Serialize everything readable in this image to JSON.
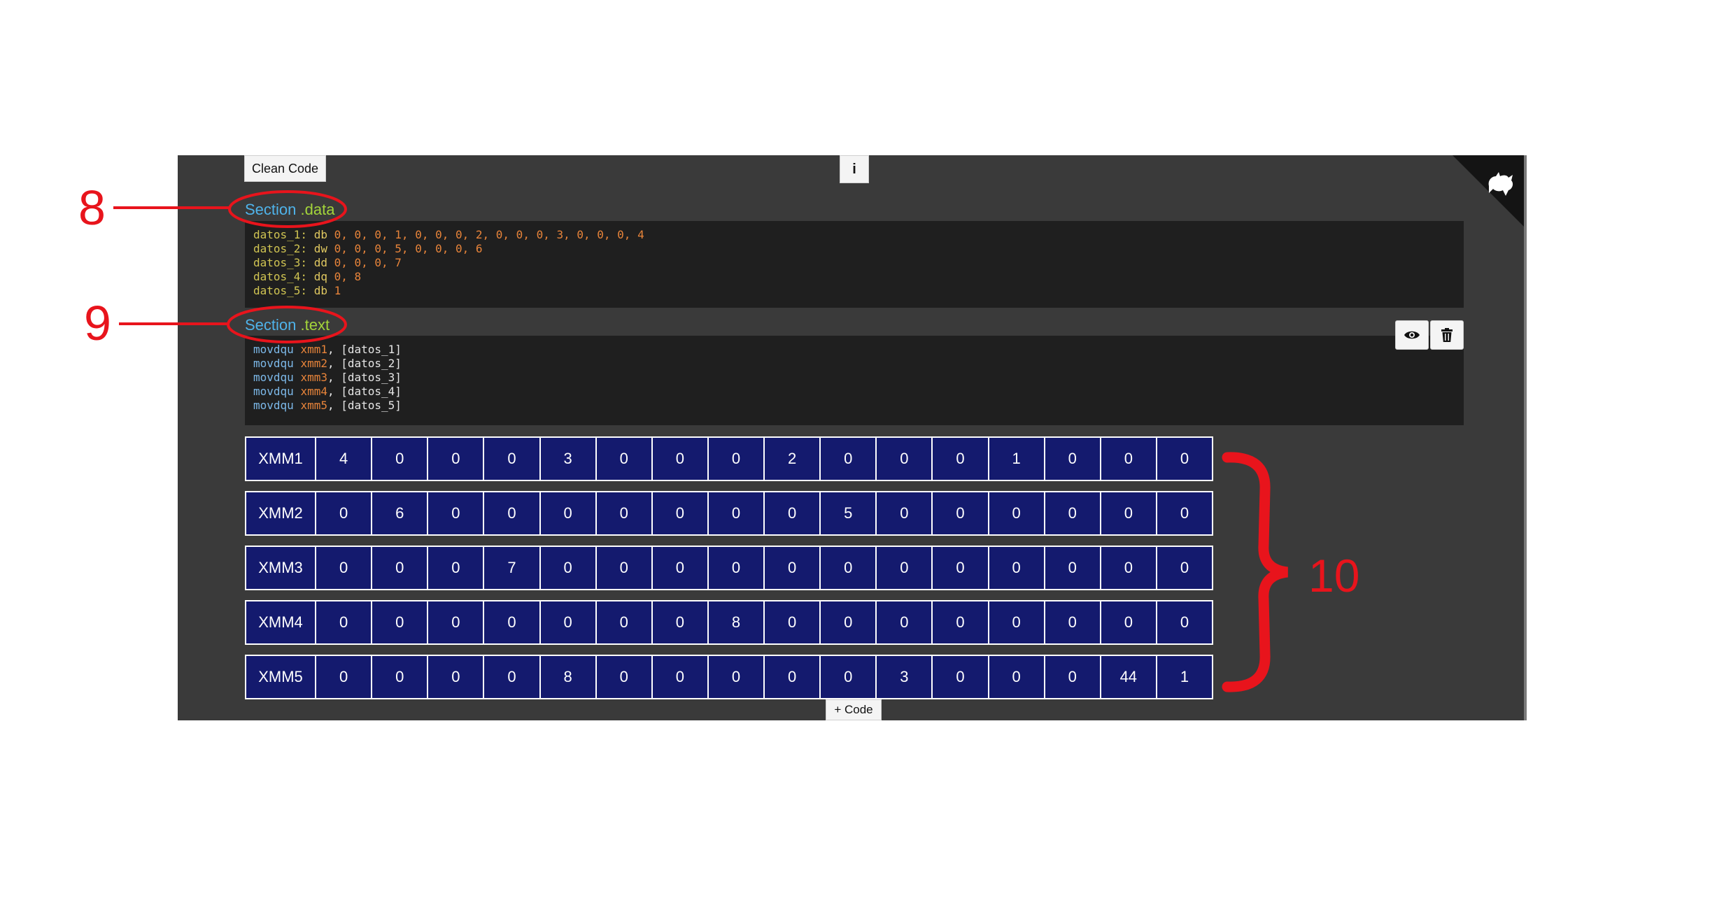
{
  "toolbar": {
    "clean_code_label": "Clean Code",
    "info_label": "i",
    "add_code_label": "+ Code"
  },
  "sections": {
    "data": {
      "keyword": "Section",
      "name": " .data"
    },
    "text": {
      "keyword": "Section",
      "name": " .text"
    }
  },
  "data_code": [
    {
      "label": "datos_1:",
      "dir": " db ",
      "values": "0, 0, 0, 1, 0, 0, 0, 2, 0, 0, 0, 3, 0, 0, 0, 4"
    },
    {
      "label": "datos_2:",
      "dir": " dw ",
      "values": "0, 0, 0, 5, 0, 0, 0, 6"
    },
    {
      "label": "datos_3:",
      "dir": " dd ",
      "values": "0, 0, 0, 7"
    },
    {
      "label": "datos_4:",
      "dir": " dq ",
      "values": "0, 8"
    },
    {
      "label": "datos_5:",
      "dir": " db ",
      "values": "1"
    }
  ],
  "text_code": [
    {
      "op": "movdqu ",
      "reg": "xmm1",
      "arg": ", [datos_1]"
    },
    {
      "op": "movdqu ",
      "reg": "xmm2",
      "arg": ", [datos_2]"
    },
    {
      "op": "movdqu ",
      "reg": "xmm3",
      "arg": ", [datos_3]"
    },
    {
      "op": "movdqu ",
      "reg": "xmm4",
      "arg": ", [datos_4]"
    },
    {
      "op": "movdqu ",
      "reg": "xmm5",
      "arg": ", [datos_5]"
    }
  ],
  "registers": [
    {
      "name": "XMM1",
      "cells": [
        "4",
        "0",
        "0",
        "0",
        "3",
        "0",
        "0",
        "0",
        "2",
        "0",
        "0",
        "0",
        "1",
        "0",
        "0",
        "0"
      ]
    },
    {
      "name": "XMM2",
      "cells": [
        "0",
        "6",
        "0",
        "0",
        "0",
        "0",
        "0",
        "0",
        "0",
        "5",
        "0",
        "0",
        "0",
        "0",
        "0",
        "0"
      ]
    },
    {
      "name": "XMM3",
      "cells": [
        "0",
        "0",
        "0",
        "7",
        "0",
        "0",
        "0",
        "0",
        "0",
        "0",
        "0",
        "0",
        "0",
        "0",
        "0",
        "0"
      ]
    },
    {
      "name": "XMM4",
      "cells": [
        "0",
        "0",
        "0",
        "0",
        "0",
        "0",
        "0",
        "8",
        "0",
        "0",
        "0",
        "0",
        "0",
        "0",
        "0",
        "0"
      ]
    },
    {
      "name": "XMM5",
      "cells": [
        "0",
        "0",
        "0",
        "0",
        "8",
        "0",
        "0",
        "0",
        "0",
        "0",
        "3",
        "0",
        "0",
        "0",
        "44",
        "1"
      ]
    }
  ],
  "annotations": {
    "label_8": "8",
    "label_9": "9",
    "label_10": "10",
    "color": "#e8141c"
  },
  "icons": {
    "corner": "github-octocat-icon",
    "view": "eye-icon",
    "delete": "trash-icon"
  },
  "colors": {
    "panel": "#3a3a3a",
    "code_bg": "#1f1f1f",
    "register_bg": "#141a6e",
    "section_keyword": "#4fb3ea",
    "section_name": "#a3d43a"
  }
}
